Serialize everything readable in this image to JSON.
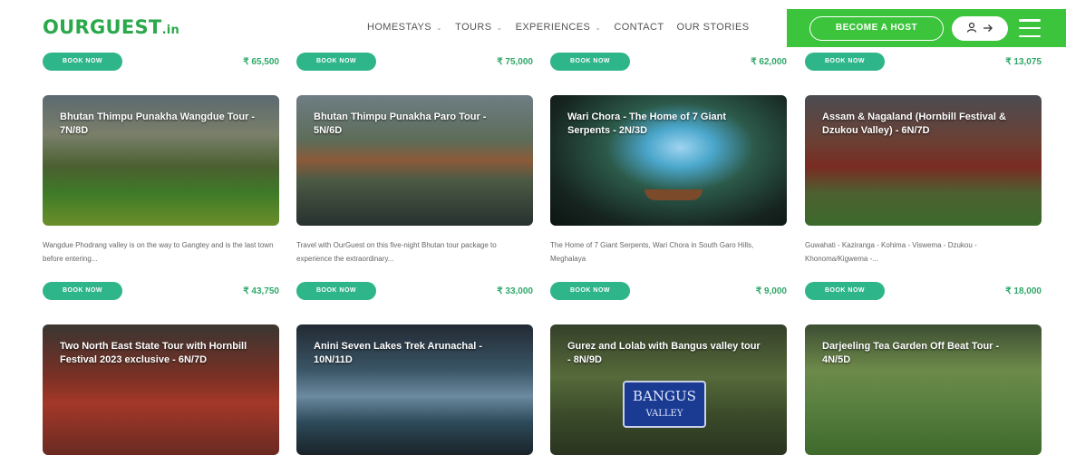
{
  "header": {
    "logo_main": "OURGUEST",
    "logo_tld": ".in",
    "nav": [
      {
        "label": "HOMESTAYS",
        "has_dropdown": true
      },
      {
        "label": "TOURS",
        "has_dropdown": true
      },
      {
        "label": "EXPERIENCES",
        "has_dropdown": true
      },
      {
        "label": "CONTACT",
        "has_dropdown": false
      },
      {
        "label": "OUR STORIES",
        "has_dropdown": false
      }
    ],
    "become_host": "BECOME A HOST",
    "user_icon": "user-icon",
    "arrow_icon": "arrow-right-icon",
    "menu_icon": "hamburger-menu-icon",
    "accent": "#3cc43c"
  },
  "row0": [
    {
      "book": "BOOK NOW",
      "price": "₹ 65,500"
    },
    {
      "book": "BOOK NOW",
      "price": "₹ 75,000"
    },
    {
      "book": "BOOK NOW",
      "price": "₹ 62,000"
    },
    {
      "book": "BOOK NOW",
      "price": "₹ 13,075"
    }
  ],
  "row1": [
    {
      "title": "Bhutan Thimpu Punakha Wangdue Tour - 7N/8D",
      "desc": "Wangdue Phodrang valley is on the way to Gangtey and is the last town before entering...",
      "book": "BOOK NOW",
      "price": "₹ 43,750"
    },
    {
      "title": "Bhutan Thimpu Punakha Paro Tour - 5N/6D",
      "desc": "Travel with OurGuest on this five-night Bhutan tour package to experience the extraordinary...",
      "book": "BOOK NOW",
      "price": "₹ 33,000"
    },
    {
      "title": "Wari Chora - The Home of 7 Giant Serpents - 2N/3D",
      "desc": "The Home of 7 Giant Serpents, Wari Chora in South Garo Hills, Meghalaya",
      "book": "BOOK NOW",
      "price": "₹ 9,000"
    },
    {
      "title": "Assam & Nagaland (Hornbill Festival & Dzukou Valley) - 6N/7D",
      "desc": "Guwahati - Kaziranga - Kohima - Viswema - Dzukou - Khonoma/Kigwema -...",
      "book": "BOOK NOW",
      "price": "₹ 18,000"
    }
  ],
  "row2": [
    {
      "title": "Two North East State Tour with Hornbill Festival 2023 exclusive - 6N/7D"
    },
    {
      "title": "Anini Seven Lakes Trek Arunachal - 10N/11D"
    },
    {
      "title": "Gurez and Lolab with Bangus valley tour - 8N/9D",
      "sign_line1": "BANGUS",
      "sign_line2": "VALLEY"
    },
    {
      "title": "Darjeeling Tea Garden Off Beat Tour - 4N/5D"
    }
  ]
}
